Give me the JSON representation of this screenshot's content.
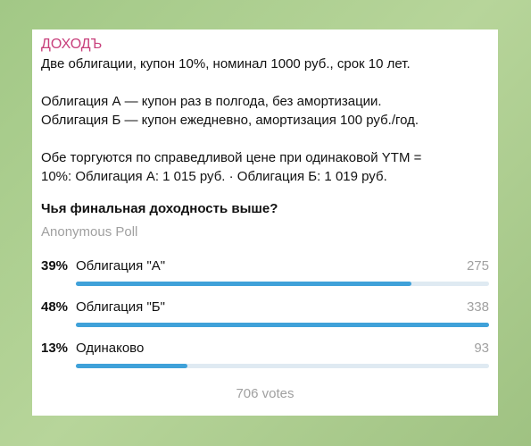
{
  "channel": {
    "name": "ДОХОДЪ"
  },
  "post": {
    "line1": "Две облигации, купон 10%, номинал 1000 руб., срок 10 лет.",
    "line2": "Облигация А — купон раз в полгода, без амортизации.",
    "line3": "Облигация Б — купон ежедневно, амортизация 100 руб./год.",
    "line4": "Обе торгуются по справедливой цене при одинаковой YTM =",
    "line5": "10%: Облигация А: 1 015 руб. · Облигация Б: 1 019 руб."
  },
  "poll": {
    "question": "Чья финальная доходность выше?",
    "type": "Anonymous Poll",
    "options": [
      {
        "percent": "39%",
        "label": "Облигация \"А\"",
        "count": "275",
        "share": 0.39
      },
      {
        "percent": "48%",
        "label": "Облигация \"Б\"",
        "count": "338",
        "share": 0.48
      },
      {
        "percent": "13%",
        "label": "Одинаково",
        "count": "93",
        "share": 0.13
      }
    ],
    "total": "706 votes"
  },
  "colors": {
    "channel": "#c8407c",
    "bar": "#3fa1d9",
    "track": "#dfeaf2"
  }
}
